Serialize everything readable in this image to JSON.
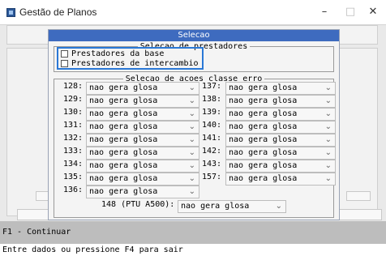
{
  "window": {
    "title": "Gestão de Planos",
    "minimize_glyph": "–",
    "maximize_glyph": "□",
    "close_glyph": "✕"
  },
  "dialog": {
    "title": "Selecao",
    "prestadores_group_title": "Selecao de prestadores",
    "checkboxes": [
      {
        "label": "Prestadores da base",
        "checked": false
      },
      {
        "label": "Prestadores de intercambio",
        "checked": false
      }
    ],
    "acoes_group_title": "Selecao de acoes classe erro",
    "left_rows": [
      {
        "code": "128:",
        "value": "nao gera glosa"
      },
      {
        "code": "129:",
        "value": "nao gera glosa"
      },
      {
        "code": "130:",
        "value": "nao gera glosa"
      },
      {
        "code": "131:",
        "value": "nao gera glosa"
      },
      {
        "code": "132:",
        "value": "nao gera glosa"
      },
      {
        "code": "133:",
        "value": "nao gera glosa"
      },
      {
        "code": "134:",
        "value": "nao gera glosa"
      },
      {
        "code": "135:",
        "value": "nao gera glosa"
      },
      {
        "code": "136:",
        "value": "nao gera glosa"
      }
    ],
    "right_rows": [
      {
        "code": "137:",
        "value": "nao gera glosa"
      },
      {
        "code": "138:",
        "value": "nao gera glosa"
      },
      {
        "code": "139:",
        "value": "nao gera glosa"
      },
      {
        "code": "140:",
        "value": "nao gera glosa"
      },
      {
        "code": "141:",
        "value": "nao gera glosa"
      },
      {
        "code": "142:",
        "value": "nao gera glosa"
      },
      {
        "code": "143:",
        "value": "nao gera glosa"
      },
      {
        "code": "157:",
        "value": "nao gera glosa"
      }
    ],
    "ptu": {
      "label": "148 (PTU A500):",
      "value": "nao gera glosa"
    }
  },
  "status": {
    "function_key": "F1 - Continuar",
    "prompt": "Entre dados ou pressione F4 para sair"
  },
  "colors": {
    "dialog_title_bg": "#3e6bbf",
    "focus_border": "#2a78d6",
    "statusbar_bg": "#bdbdbd"
  }
}
